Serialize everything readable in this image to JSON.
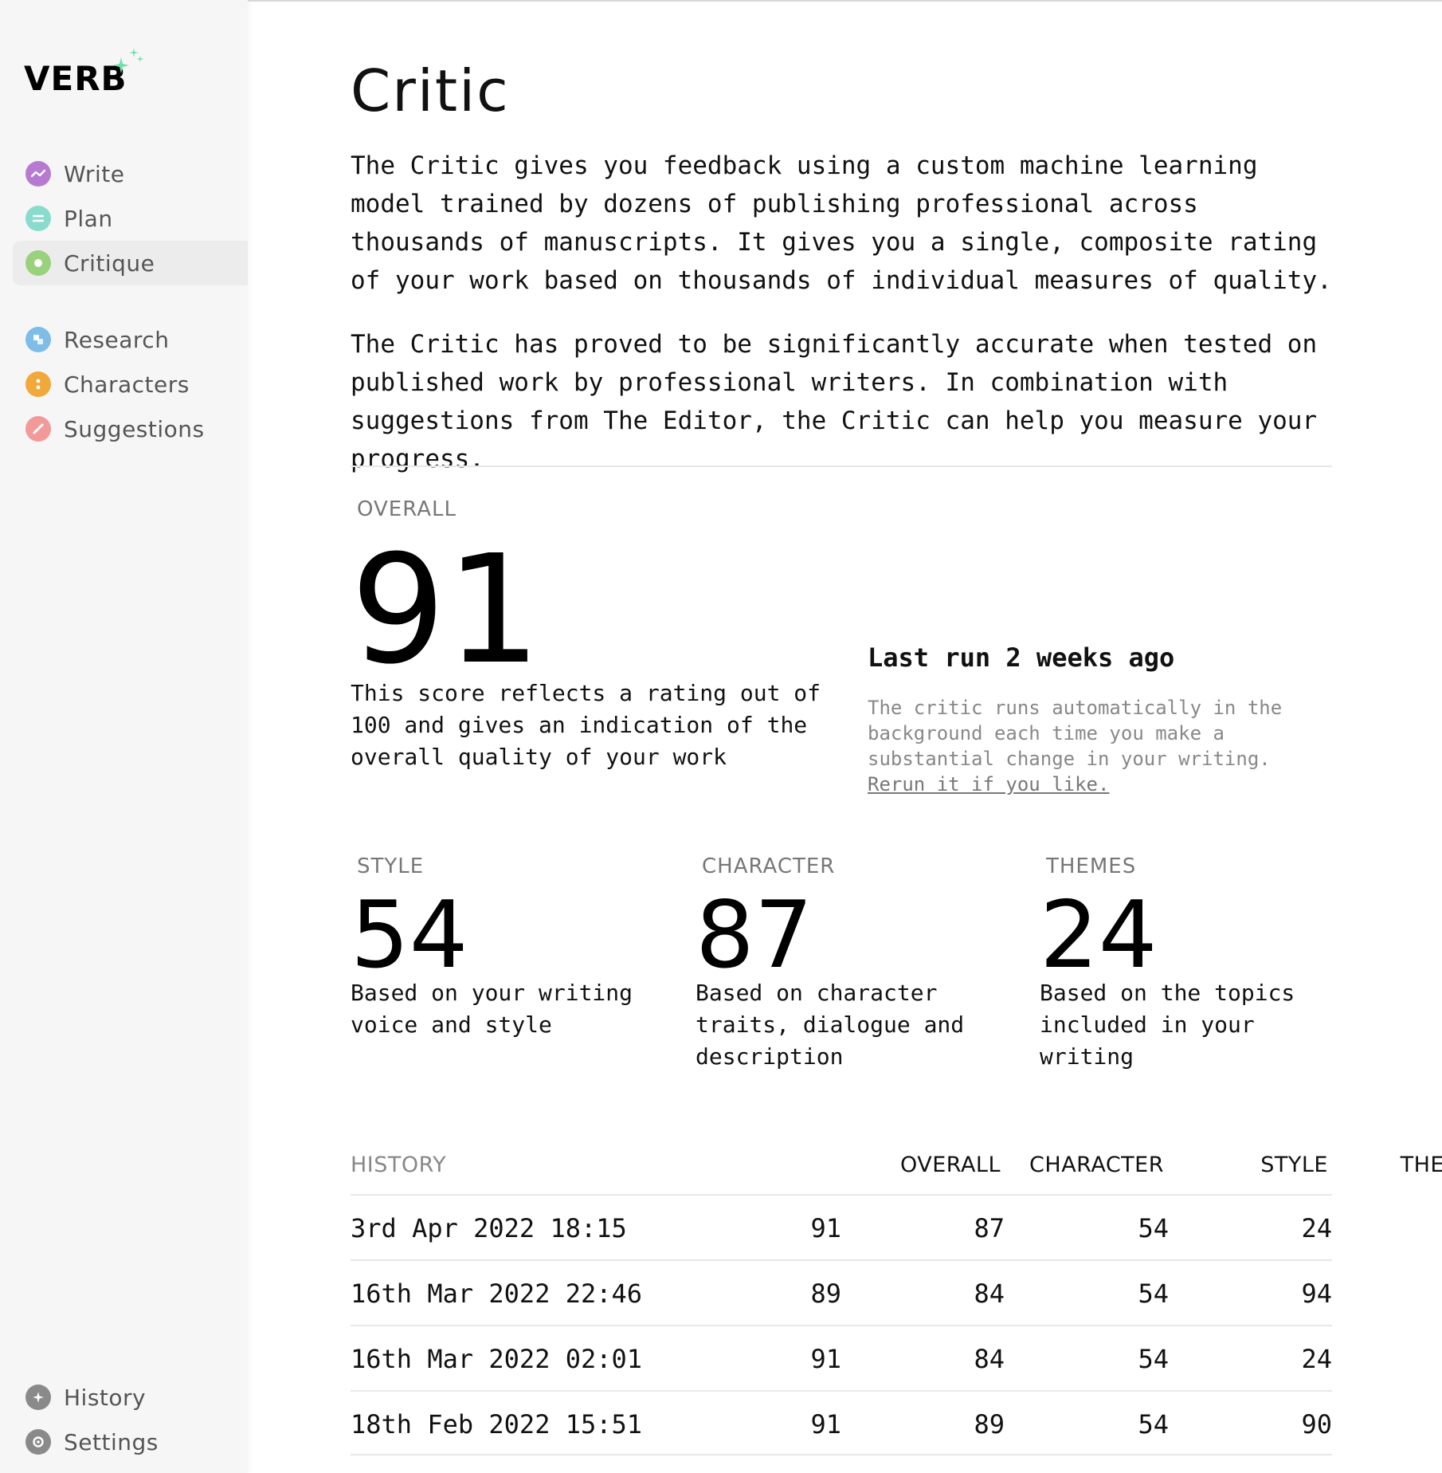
{
  "app": {
    "logo": "VERB"
  },
  "sidebar": {
    "items": [
      {
        "label": "Write",
        "icon": "trend-icon",
        "color": "#b67bd1"
      },
      {
        "label": "Plan",
        "icon": "list-icon",
        "color": "#89dccd"
      },
      {
        "label": "Critique",
        "icon": "circle-dot-icon",
        "color": "#9ad17c",
        "active": true
      },
      {
        "label": "Research",
        "icon": "research-icon",
        "color": "#7dbde8"
      },
      {
        "label": "Characters",
        "icon": "colon-icon",
        "color": "#f2a93b"
      },
      {
        "label": "Suggestions",
        "icon": "pencil-icon",
        "color": "#f29a9a"
      }
    ],
    "footer": [
      {
        "label": "History",
        "icon": "history-icon",
        "color": "#8a8a8a"
      },
      {
        "label": "Settings",
        "icon": "gear-icon",
        "color": "#8a8a8a"
      }
    ]
  },
  "page": {
    "title": "Critic",
    "intro_1": "The Critic gives you feedback using a custom machine learning model trained by dozens of publishing professional across thousands of manuscripts. It gives you a single, composite rating of your work based on thousands of individual measures of quality.",
    "intro_2": "The Critic has proved to be significantly accurate when tested on published work by professional writers. In combination with suggestions from The Editor, the Critic can help you measure your progress."
  },
  "overall": {
    "label": "OVERALL",
    "score": "91",
    "description": "This score reflects a rating out of 100 and gives an indication of the overall quality of your work"
  },
  "last_run": {
    "title": "Last run 2 weeks ago",
    "note": "The critic runs automatically in the background each time you make a substantial change in your writing.",
    "link": "Rerun it if you like."
  },
  "categories": [
    {
      "label": "STYLE",
      "score": "54",
      "description": "Based on your writing voice and style"
    },
    {
      "label": "CHARACTER",
      "score": "87",
      "description": "Based on character traits, dialogue and description"
    },
    {
      "label": "THEMES",
      "score": "24",
      "description": "Based on the topics included in your writing"
    }
  ],
  "history": {
    "headers": {
      "date": "HISTORY",
      "overall": "OVERALL",
      "character": "CHARACTER",
      "style": "STYLE",
      "themes": "THEMES"
    },
    "rows": [
      {
        "date": "3rd Apr 2022 18:15",
        "overall": "91",
        "character": "87",
        "style": "54",
        "themes": "24"
      },
      {
        "date": "16th Mar 2022 22:46",
        "overall": "89",
        "character": "84",
        "style": "54",
        "themes": "94"
      },
      {
        "date": "16th Mar 2022 02:01",
        "overall": "91",
        "character": "84",
        "style": "54",
        "themes": "24"
      },
      {
        "date": "18th Feb 2022 15:51",
        "overall": "91",
        "character": "89",
        "style": "54",
        "themes": "90"
      }
    ]
  }
}
